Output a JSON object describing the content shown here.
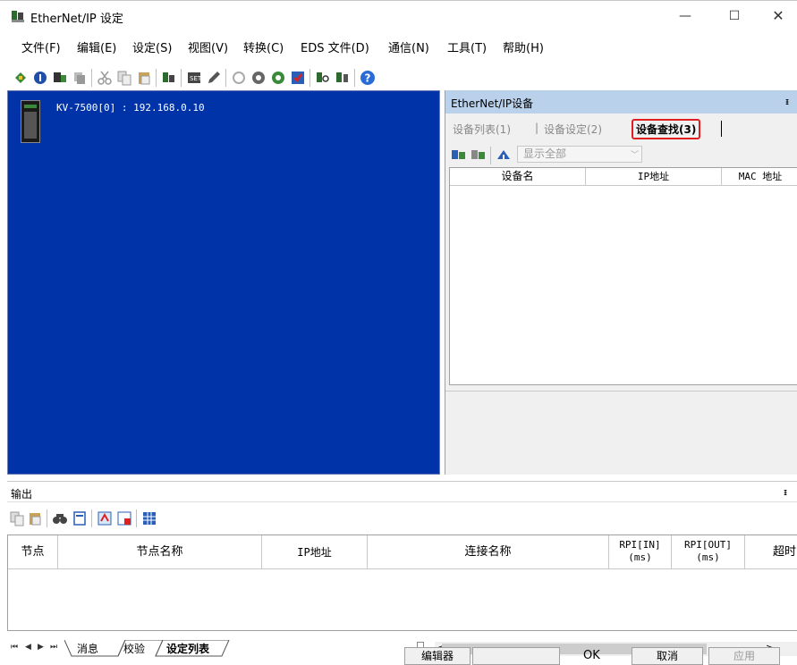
{
  "window": {
    "title": "EtherNet/IP 设定",
    "min_glyph": "—",
    "max_glyph": "☐",
    "close_glyph": "✕"
  },
  "menu": [
    {
      "label": "文件(F)"
    },
    {
      "label": "编辑(E)"
    },
    {
      "label": "设定(S)"
    },
    {
      "label": "视图(V)"
    },
    {
      "label": "转换(C)"
    },
    {
      "label": "EDS 文件(D)"
    },
    {
      "label": "通信(N)"
    },
    {
      "label": "工具(T)"
    },
    {
      "label": "帮助(H)"
    }
  ],
  "config": {
    "plc_label": "KV-7500[0] : 192.168.0.10"
  },
  "device_panel": {
    "title": "EtherNet/IP设备",
    "pin": "ᵻ",
    "tabs": [
      {
        "label": "设备列表(1)"
      },
      {
        "label": "设备设定(2)"
      },
      {
        "label": "设备查找(3)"
      }
    ],
    "tab_separator": "|",
    "filter_value": "显示全部",
    "columns": [
      "设备名",
      "IP地址",
      "MAC 地址"
    ]
  },
  "output": {
    "title": "输出",
    "pin": "ᵻ",
    "columns": [
      {
        "line1": "节点",
        "line2": ""
      },
      {
        "line1": "节点名称",
        "line2": ""
      },
      {
        "line1": "IP地址",
        "line2": ""
      },
      {
        "line1": "连接名称",
        "line2": ""
      },
      {
        "line1": "RPI[IN]",
        "line2": "(ms)"
      },
      {
        "line1": "RPI[OUT]",
        "line2": "(ms)"
      },
      {
        "line1": "超时",
        "line2": ""
      }
    ],
    "sheet_tabs": [
      {
        "label": "消息"
      },
      {
        "label": "校验"
      },
      {
        "label": "设定列表"
      }
    ],
    "nav": [
      "⏮",
      "◀",
      "▶",
      "⏭"
    ],
    "scroll_left": "<",
    "scroll_right": ">"
  },
  "statusbar": {
    "editor": "编辑器",
    "ok": "OK",
    "cancel": "取消",
    "apply": "应用"
  },
  "colors": {
    "config_bg": "#0033a8",
    "panel_header": "#b9d1ea",
    "highlight": "#e02020"
  }
}
